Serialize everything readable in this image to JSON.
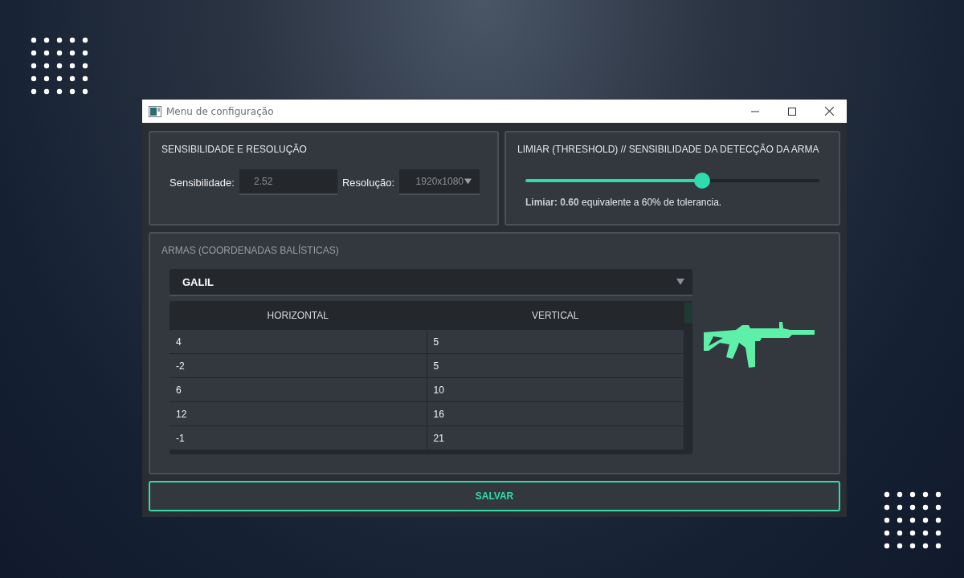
{
  "window": {
    "title": "Menu de configuração"
  },
  "sensitivity_panel": {
    "title": "SENSIBILIDADE E RESOLUÇÃO",
    "sensitivity_label": "Sensibilidade:",
    "sensitivity_value": "2.52",
    "resolution_label": "Resolução:",
    "resolution_value": "1920x1080"
  },
  "threshold_panel": {
    "title": "LIMIAR (THRESHOLD) // SENSIBILIDADE DA DETECÇÃO DA ARMA",
    "slider": {
      "level": 0.6
    },
    "caption": "**Limiar: 0.60** equivalente a 60% de tolerancia."
  },
  "weapons_panel": {
    "title": "ARMAS (COORDENADAS BALÍSTICAS)",
    "weapon": "GALIL",
    "table": {
      "columns": [
        "HORIZONTAL",
        "VERTICAL"
      ],
      "rows": [
        [
          "4",
          "5"
        ],
        [
          "-2",
          "5"
        ],
        [
          "6",
          "10"
        ],
        [
          "12",
          "16"
        ],
        [
          "-1",
          "21"
        ]
      ]
    }
  },
  "save_button": "SALVAR"
}
